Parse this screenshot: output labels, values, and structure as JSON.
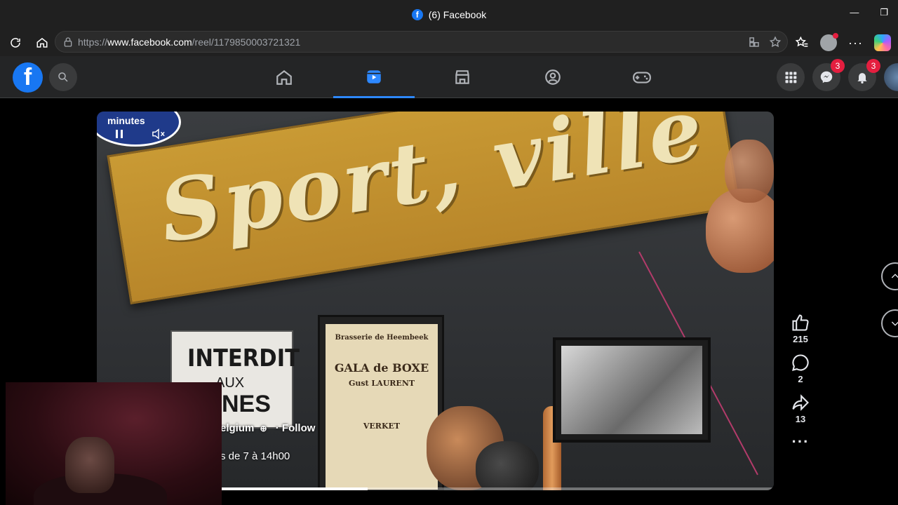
{
  "browser": {
    "window_title": "(6) Facebook",
    "url_prefix": "https://",
    "url_host": "www.facebook.com",
    "url_path": "/reel/1179850003721321"
  },
  "fb": {
    "messenger_badge": "3",
    "notifications_badge": "3",
    "nav_items": [
      "home-icon",
      "reels-icon",
      "marketplace-icon",
      "groups-icon",
      "gaming-icon"
    ]
  },
  "video": {
    "sign_text": "Sport, ville",
    "poster1_line1": "INTERDIT",
    "poster1_line2": "AUX",
    "poster1_line3": "ONNES",
    "poster2_header": "Brasserie de Heembeek",
    "poster2_title": "GALA de BOXE",
    "poster2_sub": "Gust LAURENT",
    "poster2_bottom": "VERKET",
    "badge_text": "minutes",
    "page_name": "elgium",
    "follow": "· Follow",
    "caption": "s de 7 à 14h00",
    "progress": 0.4
  },
  "actions": {
    "likes": "215",
    "comments": "2",
    "shares": "13"
  },
  "colors": {
    "fb_blue": "#1877f2",
    "active_tab": "#2d88ff",
    "badge_red": "#e41e3f"
  }
}
